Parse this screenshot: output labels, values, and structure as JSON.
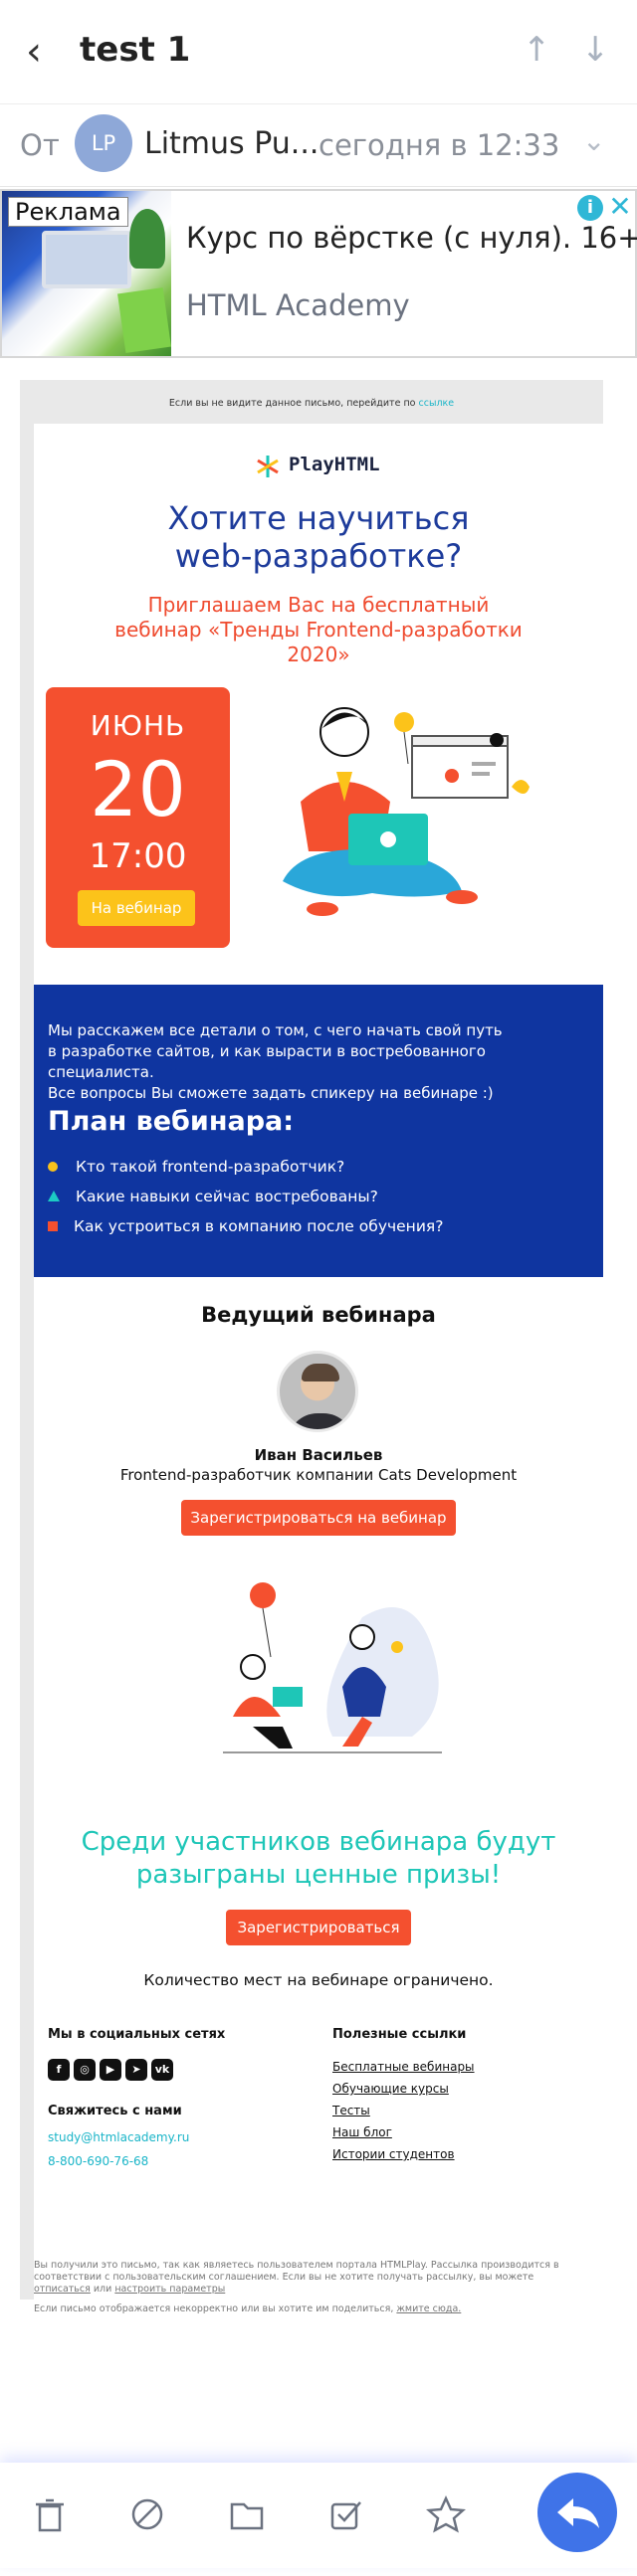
{
  "header": {
    "subject": "test 1"
  },
  "sender": {
    "from_label": "От",
    "avatar_initials": "LP",
    "name": "Litmus Pu...",
    "time": "сегодня в 12:33"
  },
  "ad": {
    "badge": "Реклама",
    "title": "Курс по вёрстке (с нуля). 16+",
    "subtitle": "HTML Academy",
    "info_icon": "i",
    "close_icon": "✕"
  },
  "email": {
    "preheader_text": "Если вы не видите данное письмо, перейдите по ",
    "preheader_link": "ссылке",
    "logo": "PlayHTML",
    "hero_title_1": "Хотите научиться",
    "hero_title_2": "web-разработке?",
    "hero_sub_1": "Приглашаем Вас на бесплатный",
    "hero_sub_2": "вебинар «Тренды Frontend-разработки",
    "hero_sub_3": "2020»",
    "date_month": "ИЮНЬ",
    "date_day": "20",
    "date_time": "17:00",
    "date_button": "На вебинар",
    "intro_1": "Мы расскажем все детали о том, с чего начать свой путь",
    "intro_2": "в разработке сайтов, и как вырасти в востребованного специалиста.",
    "intro_3": "Все вопросы Вы сможете задать спикеру на вебинаре :)",
    "plan_title": "План вебинара:",
    "plan_items": [
      "Кто такой frontend-разработчик?",
      "Какие навыки сейчас востребованы?",
      "Как устроиться в компанию после обучения?"
    ],
    "host_title": "Ведущий вебинара",
    "host_name": "Иван Васильев",
    "host_role": "Frontend-разработчик компании Cats Development",
    "register_button_1": "Зарегистрироваться на вебинар",
    "prize_1": "Среди участников вебинара будут",
    "prize_2": "разыграны ценные призы!",
    "register_button_2": "Зарегистрироваться",
    "limited": "Количество мест на вебинаре ограничено.",
    "footer": {
      "social_head": "Мы в социальных сетях",
      "social_icons": [
        "facebook-icon",
        "instagram-icon",
        "youtube-icon",
        "telegram-icon",
        "vk-icon"
      ],
      "contact_head": "Свяжитесь с нами",
      "email": "study@htmlacademy.ru",
      "phone": "8-800-690-76-68",
      "links_head": "Полезные ссылки",
      "links": [
        "Бесплатные вебинары",
        "Обучающие курсы",
        "Тесты",
        "Наш блог",
        "Истории студентов"
      ]
    },
    "disclaimer_1": "Вы получили это письмо, так как являетесь пользователем портала HTMLPlay. Рассылка производится в соответствии с пользовательским соглашением. Если вы не хотите получать рассылку, вы можете ",
    "disclaimer_unsub": "отписаться",
    "disclaimer_or": " или ",
    "disclaimer_settings": "настроить параметры",
    "disclaimer_2": "Если письмо отображается некорректно или вы хотите им поделиться, ",
    "disclaimer_2_link": "жмите сюда."
  },
  "colors": {
    "accent_blue": "#0f35a0",
    "accent_red": "#f4502f",
    "accent_teal": "#1ec6b7",
    "accent_yellow": "#fcc31a"
  }
}
